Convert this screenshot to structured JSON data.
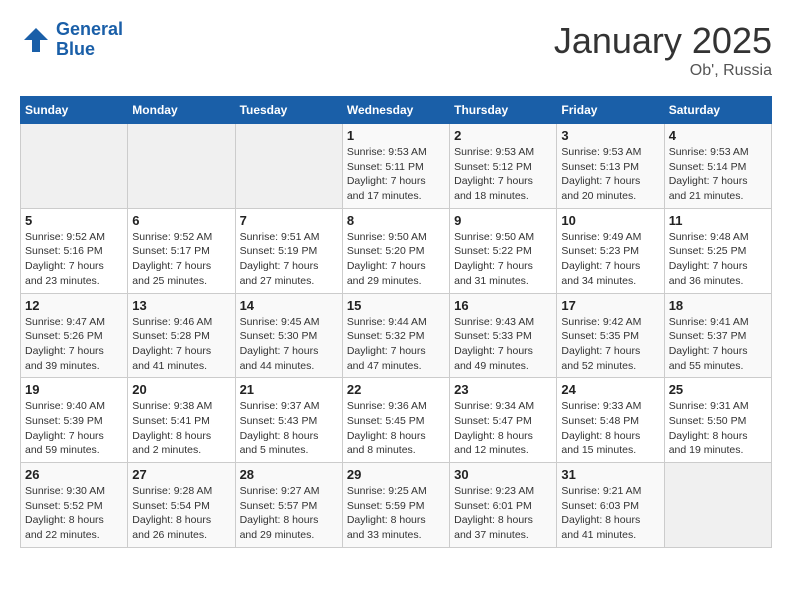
{
  "logo": {
    "line1": "General",
    "line2": "Blue"
  },
  "title": "January 2025",
  "location": "Ob', Russia",
  "days_header": [
    "Sunday",
    "Monday",
    "Tuesday",
    "Wednesday",
    "Thursday",
    "Friday",
    "Saturday"
  ],
  "weeks": [
    [
      {
        "day": "",
        "info": ""
      },
      {
        "day": "",
        "info": ""
      },
      {
        "day": "",
        "info": ""
      },
      {
        "day": "1",
        "info": "Sunrise: 9:53 AM\nSunset: 5:11 PM\nDaylight: 7 hours\nand 17 minutes."
      },
      {
        "day": "2",
        "info": "Sunrise: 9:53 AM\nSunset: 5:12 PM\nDaylight: 7 hours\nand 18 minutes."
      },
      {
        "day": "3",
        "info": "Sunrise: 9:53 AM\nSunset: 5:13 PM\nDaylight: 7 hours\nand 20 minutes."
      },
      {
        "day": "4",
        "info": "Sunrise: 9:53 AM\nSunset: 5:14 PM\nDaylight: 7 hours\nand 21 minutes."
      }
    ],
    [
      {
        "day": "5",
        "info": "Sunrise: 9:52 AM\nSunset: 5:16 PM\nDaylight: 7 hours\nand 23 minutes."
      },
      {
        "day": "6",
        "info": "Sunrise: 9:52 AM\nSunset: 5:17 PM\nDaylight: 7 hours\nand 25 minutes."
      },
      {
        "day": "7",
        "info": "Sunrise: 9:51 AM\nSunset: 5:19 PM\nDaylight: 7 hours\nand 27 minutes."
      },
      {
        "day": "8",
        "info": "Sunrise: 9:50 AM\nSunset: 5:20 PM\nDaylight: 7 hours\nand 29 minutes."
      },
      {
        "day": "9",
        "info": "Sunrise: 9:50 AM\nSunset: 5:22 PM\nDaylight: 7 hours\nand 31 minutes."
      },
      {
        "day": "10",
        "info": "Sunrise: 9:49 AM\nSunset: 5:23 PM\nDaylight: 7 hours\nand 34 minutes."
      },
      {
        "day": "11",
        "info": "Sunrise: 9:48 AM\nSunset: 5:25 PM\nDaylight: 7 hours\nand 36 minutes."
      }
    ],
    [
      {
        "day": "12",
        "info": "Sunrise: 9:47 AM\nSunset: 5:26 PM\nDaylight: 7 hours\nand 39 minutes."
      },
      {
        "day": "13",
        "info": "Sunrise: 9:46 AM\nSunset: 5:28 PM\nDaylight: 7 hours\nand 41 minutes."
      },
      {
        "day": "14",
        "info": "Sunrise: 9:45 AM\nSunset: 5:30 PM\nDaylight: 7 hours\nand 44 minutes."
      },
      {
        "day": "15",
        "info": "Sunrise: 9:44 AM\nSunset: 5:32 PM\nDaylight: 7 hours\nand 47 minutes."
      },
      {
        "day": "16",
        "info": "Sunrise: 9:43 AM\nSunset: 5:33 PM\nDaylight: 7 hours\nand 49 minutes."
      },
      {
        "day": "17",
        "info": "Sunrise: 9:42 AM\nSunset: 5:35 PM\nDaylight: 7 hours\nand 52 minutes."
      },
      {
        "day": "18",
        "info": "Sunrise: 9:41 AM\nSunset: 5:37 PM\nDaylight: 7 hours\nand 55 minutes."
      }
    ],
    [
      {
        "day": "19",
        "info": "Sunrise: 9:40 AM\nSunset: 5:39 PM\nDaylight: 7 hours\nand 59 minutes."
      },
      {
        "day": "20",
        "info": "Sunrise: 9:38 AM\nSunset: 5:41 PM\nDaylight: 8 hours\nand 2 minutes."
      },
      {
        "day": "21",
        "info": "Sunrise: 9:37 AM\nSunset: 5:43 PM\nDaylight: 8 hours\nand 5 minutes."
      },
      {
        "day": "22",
        "info": "Sunrise: 9:36 AM\nSunset: 5:45 PM\nDaylight: 8 hours\nand 8 minutes."
      },
      {
        "day": "23",
        "info": "Sunrise: 9:34 AM\nSunset: 5:47 PM\nDaylight: 8 hours\nand 12 minutes."
      },
      {
        "day": "24",
        "info": "Sunrise: 9:33 AM\nSunset: 5:48 PM\nDaylight: 8 hours\nand 15 minutes."
      },
      {
        "day": "25",
        "info": "Sunrise: 9:31 AM\nSunset: 5:50 PM\nDaylight: 8 hours\nand 19 minutes."
      }
    ],
    [
      {
        "day": "26",
        "info": "Sunrise: 9:30 AM\nSunset: 5:52 PM\nDaylight: 8 hours\nand 22 minutes."
      },
      {
        "day": "27",
        "info": "Sunrise: 9:28 AM\nSunset: 5:54 PM\nDaylight: 8 hours\nand 26 minutes."
      },
      {
        "day": "28",
        "info": "Sunrise: 9:27 AM\nSunset: 5:57 PM\nDaylight: 8 hours\nand 29 minutes."
      },
      {
        "day": "29",
        "info": "Sunrise: 9:25 AM\nSunset: 5:59 PM\nDaylight: 8 hours\nand 33 minutes."
      },
      {
        "day": "30",
        "info": "Sunrise: 9:23 AM\nSunset: 6:01 PM\nDaylight: 8 hours\nand 37 minutes."
      },
      {
        "day": "31",
        "info": "Sunrise: 9:21 AM\nSunset: 6:03 PM\nDaylight: 8 hours\nand 41 minutes."
      },
      {
        "day": "",
        "info": ""
      }
    ]
  ]
}
